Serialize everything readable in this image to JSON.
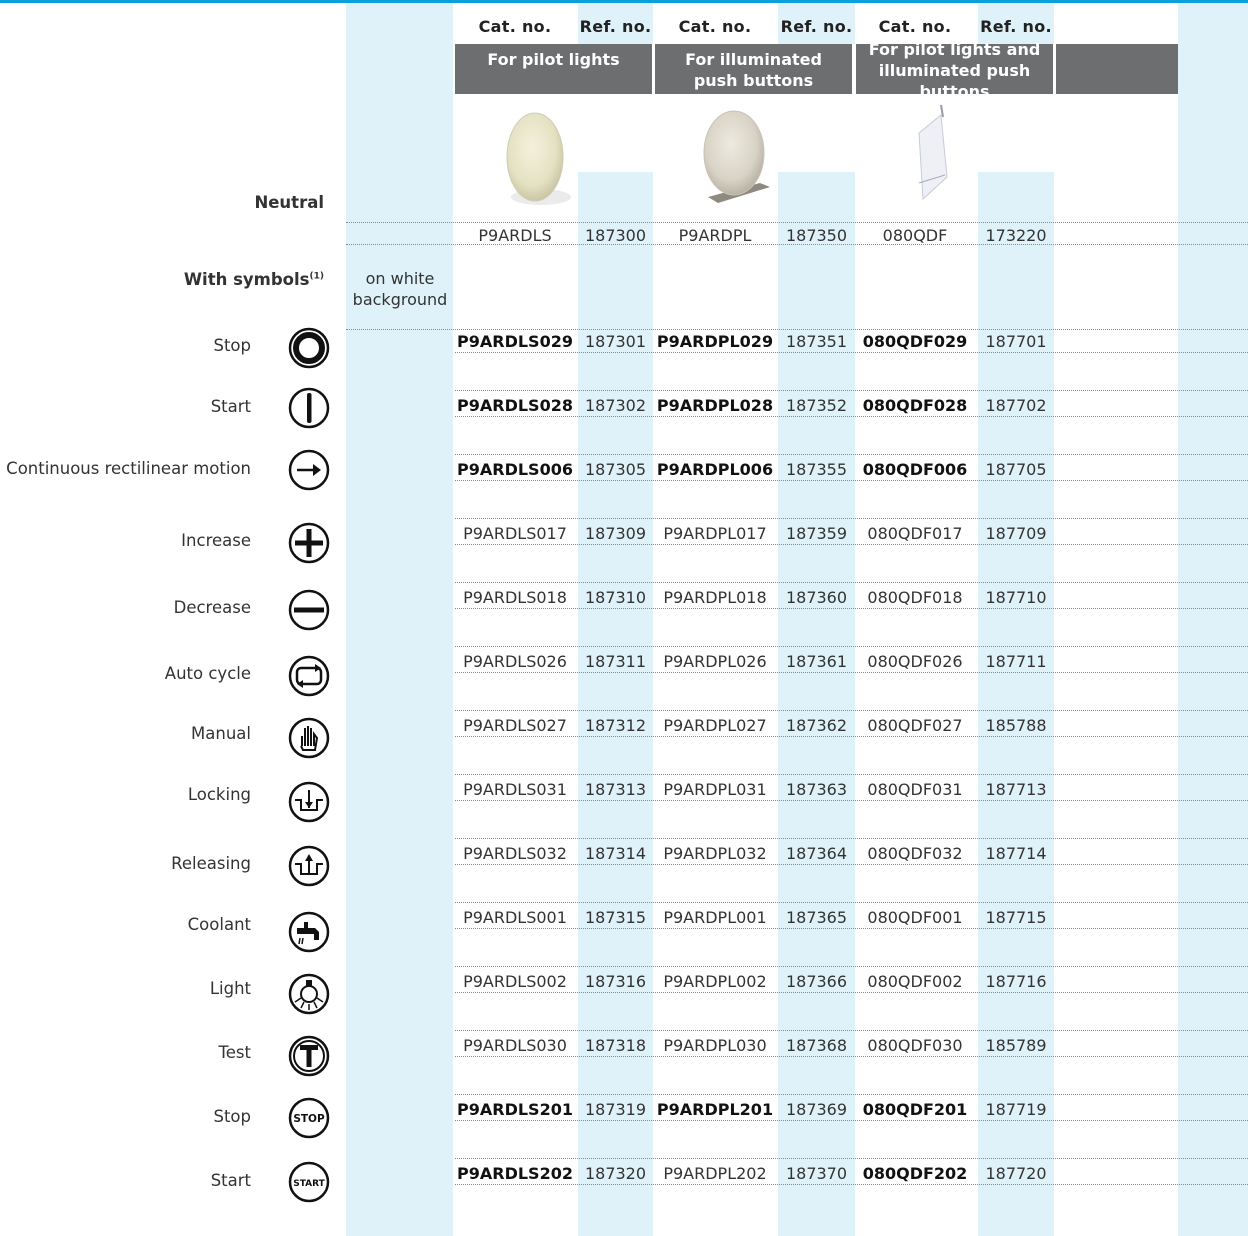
{
  "columns": {
    "headers": [
      "Cat. no.",
      "Ref. no.",
      "Cat. no.",
      "Ref. no.",
      "Cat. no.",
      "Ref. no."
    ],
    "groups": [
      {
        "line1": "For pilot lights",
        "line2": ""
      },
      {
        "line1": "For illuminated",
        "line2": "push buttons"
      },
      {
        "line1": "For pilot lights and",
        "line2": "illuminated push buttons"
      }
    ]
  },
  "neutral": {
    "label": "Neutral",
    "values": [
      "P9ARDLS",
      "187300",
      "P9ARDPL",
      "187350",
      "080QDF",
      "173220"
    ]
  },
  "symbols_header": {
    "label": "With symbols",
    "superscript": "(1)",
    "note_line1": "on white",
    "note_line2": "background"
  },
  "rows": [
    {
      "label": "Stop",
      "icon": "stop-ring-icon",
      "values": [
        "P9ARDLS029",
        "187301",
        "P9ARDPL029",
        "187351",
        "080QDF029",
        "187701"
      ],
      "bold": [
        true,
        false,
        true,
        false,
        true,
        false
      ]
    },
    {
      "label": "Start",
      "icon": "start-bar-icon",
      "values": [
        "P9ARDLS028",
        "187302",
        "P9ARDPL028",
        "187352",
        "080QDF028",
        "187702"
      ],
      "bold": [
        true,
        false,
        true,
        false,
        true,
        false
      ]
    },
    {
      "label": "Continuous rectilinear motion",
      "icon": "arrow-right-icon",
      "values": [
        "P9ARDLS006",
        "187305",
        "P9ARDPL006",
        "187355",
        "080QDF006",
        "187705"
      ],
      "bold": [
        true,
        false,
        true,
        false,
        true,
        false
      ]
    },
    {
      "label": "Increase",
      "icon": "plus-icon",
      "values": [
        "P9ARDLS017",
        "187309",
        "P9ARDPL017",
        "187359",
        "080QDF017",
        "187709"
      ],
      "bold": [
        false,
        false,
        false,
        false,
        false,
        false
      ]
    },
    {
      "label": "Decrease",
      "icon": "minus-icon",
      "values": [
        "P9ARDLS018",
        "187310",
        "P9ARDPL018",
        "187360",
        "080QDF018",
        "187710"
      ],
      "bold": [
        false,
        false,
        false,
        false,
        false,
        false
      ]
    },
    {
      "label": "Auto cycle",
      "icon": "auto-cycle-icon",
      "values": [
        "P9ARDLS026",
        "187311",
        "P9ARDPL026",
        "187361",
        "080QDF026",
        "187711"
      ],
      "bold": [
        false,
        false,
        false,
        false,
        false,
        false
      ]
    },
    {
      "label": "Manual",
      "icon": "hand-icon",
      "values": [
        "P9ARDLS027",
        "187312",
        "P9ARDPL027",
        "187362",
        "080QDF027",
        "185788"
      ],
      "bold": [
        false,
        false,
        false,
        false,
        false,
        false
      ]
    },
    {
      "label": "Locking",
      "icon": "locking-icon",
      "values": [
        "P9ARDLS031",
        "187313",
        "P9ARDPL031",
        "187363",
        "080QDF031",
        "187713"
      ],
      "bold": [
        false,
        false,
        false,
        false,
        false,
        false
      ]
    },
    {
      "label": "Releasing",
      "icon": "releasing-icon",
      "values": [
        "P9ARDLS032",
        "187314",
        "P9ARDPL032",
        "187364",
        "080QDF032",
        "187714"
      ],
      "bold": [
        false,
        false,
        false,
        false,
        false,
        false
      ]
    },
    {
      "label": "Coolant",
      "icon": "coolant-tap-icon",
      "values": [
        "P9ARDLS001",
        "187315",
        "P9ARDPL001",
        "187365",
        "080QDF001",
        "187715"
      ],
      "bold": [
        false,
        false,
        false,
        false,
        false,
        false
      ]
    },
    {
      "label": "Light",
      "icon": "light-bulb-icon",
      "values": [
        "P9ARDLS002",
        "187316",
        "P9ARDPL002",
        "187366",
        "080QDF002",
        "187716"
      ],
      "bold": [
        false,
        false,
        false,
        false,
        false,
        false
      ]
    },
    {
      "label": "Test",
      "icon": "test-t-icon",
      "values": [
        "P9ARDLS030",
        "187318",
        "P9ARDPL030",
        "187368",
        "080QDF030",
        "185789"
      ],
      "bold": [
        false,
        false,
        false,
        false,
        false,
        false
      ]
    },
    {
      "label": "Stop",
      "icon": "stop-text-icon",
      "icon_text": "STOP",
      "values": [
        "P9ARDLS201",
        "187319",
        "P9ARDPL201",
        "187369",
        "080QDF201",
        "187719"
      ],
      "bold": [
        true,
        false,
        true,
        false,
        true,
        false
      ]
    },
    {
      "label": "Start",
      "icon": "start-text-icon",
      "icon_text": "START",
      "values": [
        "P9ARDLS202",
        "187320",
        "P9ARDPL202",
        "187370",
        "080QDF202",
        "187720"
      ],
      "bold": [
        true,
        false,
        false,
        false,
        true,
        false
      ]
    }
  ]
}
